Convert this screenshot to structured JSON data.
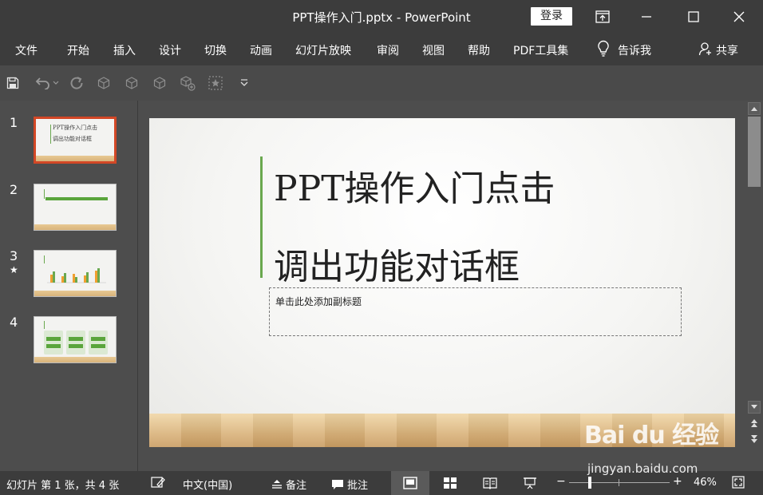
{
  "window": {
    "title": "PPT操作入门.pptx  -  PowerPoint",
    "login_label": "登录"
  },
  "menu": {
    "items": [
      "文件",
      "开始",
      "插入",
      "设计",
      "切换",
      "动画",
      "幻灯片放映",
      "审阅",
      "视图",
      "帮助",
      "PDF工具集"
    ],
    "tell_me": "告诉我",
    "share": "共享"
  },
  "qat": {
    "icons": [
      "save-icon",
      "undo-icon",
      "redo-icon",
      "cube-icon",
      "cube-icon",
      "cube-icon",
      "cube-add-icon",
      "star-frame-icon",
      "chevron-down-icon"
    ]
  },
  "thumbnails": {
    "numbers": [
      "1",
      "2",
      "3",
      "4"
    ],
    "star_glyph": "★",
    "slide1_title_line1": "PPT操作入门点击",
    "slide1_title_line2": "调出功能对话框"
  },
  "slide": {
    "title_line1": "PPT操作入门点击",
    "title_line2": "调出功能对话框",
    "subtitle_placeholder": "单击此处添加副标题"
  },
  "status": {
    "slide_info": "幻灯片 第 1 张，共 4 张",
    "language": "中文(中国)",
    "notes": "备注",
    "comments": "批注",
    "zoom_minus": "−",
    "zoom_plus": "+",
    "zoom_level": "46%"
  },
  "watermark": {
    "logo": "Bai du 经验",
    "url": "jingyan.baidu.com"
  },
  "colors": {
    "titlebar_bg": "#3c3c3c",
    "pane_bg": "#4d4d4d",
    "active_thumb_border": "#d24726",
    "accent_green": "#6aa84f"
  }
}
